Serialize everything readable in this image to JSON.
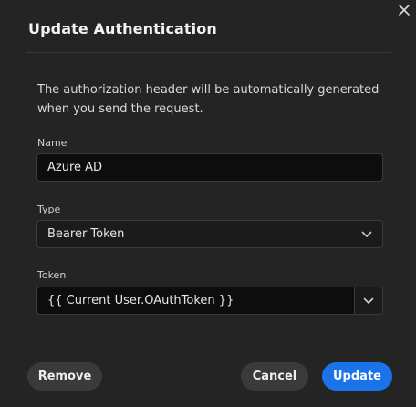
{
  "dialog": {
    "title": "Update Authentication",
    "description": "The authorization header will be automatically generated when you send the request."
  },
  "fields": {
    "name": {
      "label": "Name",
      "value": "Azure AD"
    },
    "type": {
      "label": "Type",
      "value": "Bearer Token"
    },
    "token": {
      "label": "Token",
      "value": "{{ Current User.OAuthToken }}"
    }
  },
  "actions": {
    "remove_label": "Remove",
    "cancel_label": "Cancel",
    "update_label": "Update"
  },
  "icons": {
    "close": "close-icon",
    "type_dropdown": "chevron-down-icon",
    "token_dropdown": "chevron-down-icon"
  },
  "colors": {
    "background": "#242424",
    "input_background": "#0d0d0d",
    "primary": "#1a73e8",
    "secondary_button": "#3a3a3a"
  }
}
